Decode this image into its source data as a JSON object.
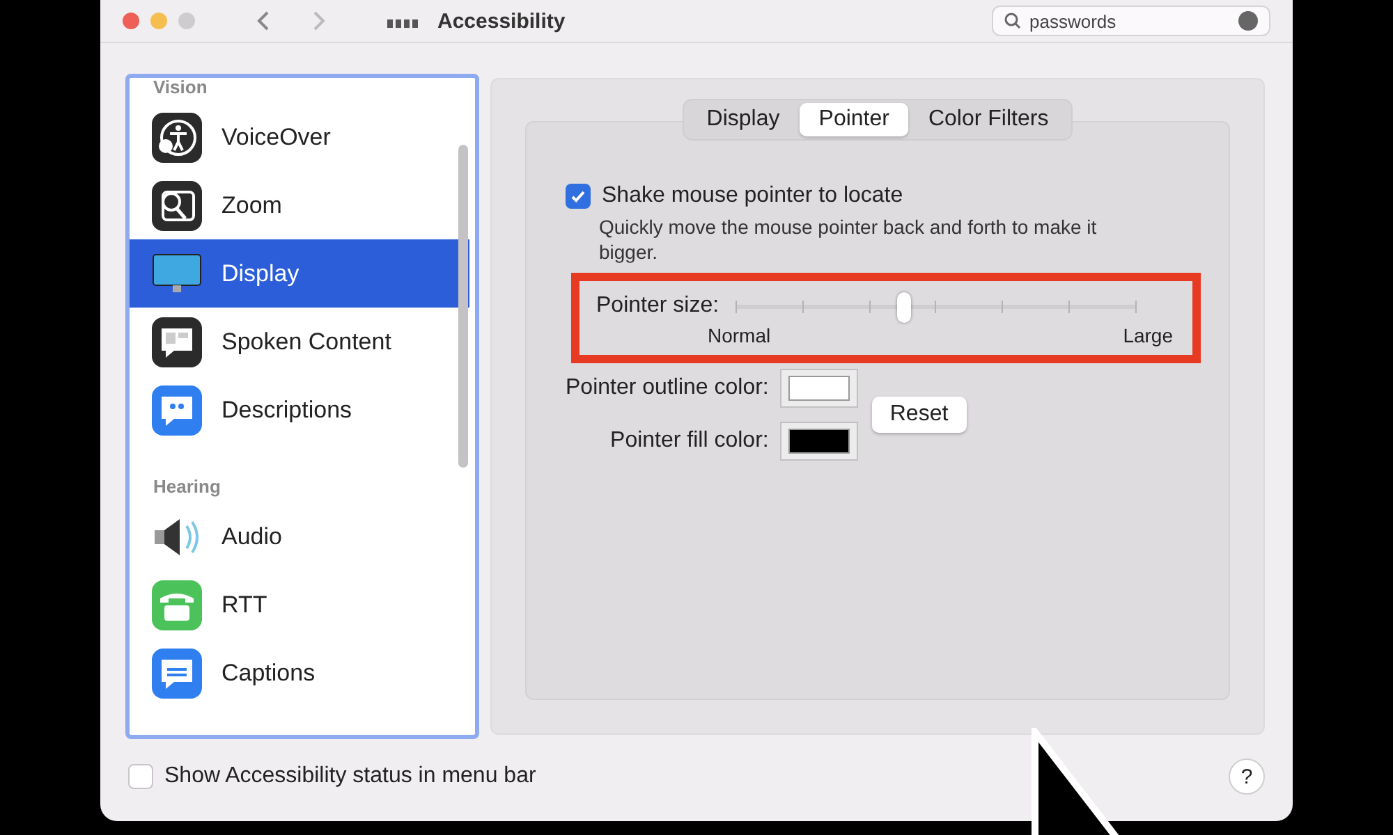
{
  "window": {
    "title": "Accessibility"
  },
  "search": {
    "value": "passwords"
  },
  "sidebar": {
    "sections": [
      {
        "title": "Vision",
        "items": [
          {
            "label": "VoiceOver",
            "selected": false
          },
          {
            "label": "Zoom",
            "selected": false
          },
          {
            "label": "Display",
            "selected": true
          },
          {
            "label": "Spoken Content",
            "selected": false
          },
          {
            "label": "Descriptions",
            "selected": false
          }
        ]
      },
      {
        "title": "Hearing",
        "items": [
          {
            "label": "Audio",
            "selected": false
          },
          {
            "label": "RTT",
            "selected": false
          },
          {
            "label": "Captions",
            "selected": false
          }
        ]
      }
    ]
  },
  "tabs": [
    {
      "label": "Display",
      "selected": false
    },
    {
      "label": "Pointer",
      "selected": true
    },
    {
      "label": "Color Filters",
      "selected": false
    }
  ],
  "shake": {
    "label": "Shake mouse pointer to locate",
    "checked": true,
    "description": "Quickly move the mouse pointer back and forth to make it bigger."
  },
  "pointer_size": {
    "label": "Pointer size:",
    "level": 0.42,
    "min_label": "Normal",
    "max_label": "Large"
  },
  "colors": [
    {
      "label": "Pointer outline color:",
      "color": "#ffffff"
    },
    {
      "label": "Pointer fill color:",
      "color": "#000000"
    }
  ],
  "reset_button": "Reset",
  "status_checkbox": {
    "label": "Show Accessibility status in menu bar",
    "checked": false
  },
  "help_button": "?"
}
